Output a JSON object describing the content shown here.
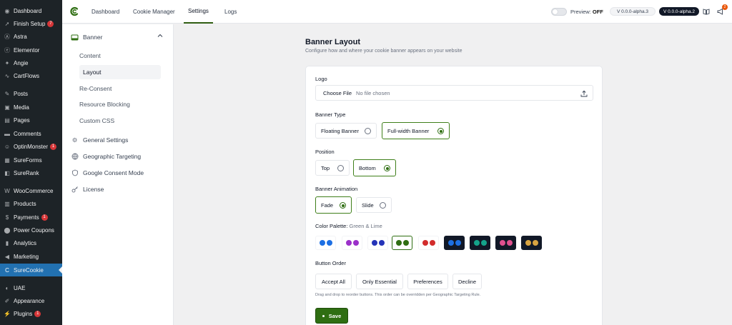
{
  "wp_sidebar": {
    "items": [
      {
        "label": "Dashboard",
        "icon": "dashboard-icon"
      },
      {
        "label": "Finish Setup",
        "icon": "rocket-icon",
        "badge": "7"
      },
      {
        "label": "Astra",
        "icon": "astra-icon"
      },
      {
        "label": "Elementor",
        "icon": "elementor-icon"
      },
      {
        "label": "Angie",
        "icon": "angie-icon"
      },
      {
        "label": "CartFlows",
        "icon": "cartflows-icon"
      },
      {
        "label": "Posts",
        "icon": "pin-icon"
      },
      {
        "label": "Media",
        "icon": "media-icon"
      },
      {
        "label": "Pages",
        "icon": "page-icon"
      },
      {
        "label": "Comments",
        "icon": "comment-icon"
      },
      {
        "label": "OptinMonster",
        "icon": "optinmonster-icon",
        "badge": "1"
      },
      {
        "label": "SureForms",
        "icon": "sureforms-icon"
      },
      {
        "label": "SureRank",
        "icon": "surerank-icon"
      },
      {
        "label": "WooCommerce",
        "icon": "woocommerce-icon"
      },
      {
        "label": "Products",
        "icon": "products-icon"
      },
      {
        "label": "Payments",
        "icon": "payments-icon",
        "badge": "1"
      },
      {
        "label": "Power Coupons",
        "icon": "coupon-icon"
      },
      {
        "label": "Analytics",
        "icon": "analytics-icon"
      },
      {
        "label": "Marketing",
        "icon": "megaphone-icon"
      },
      {
        "label": "SureCookie",
        "icon": "surecookie-icon"
      },
      {
        "label": "UAE",
        "icon": "uae-icon"
      },
      {
        "label": "Appearance",
        "icon": "brush-icon"
      },
      {
        "label": "Plugins",
        "icon": "plugin-icon",
        "badge": "1"
      }
    ]
  },
  "topbar": {
    "tabs": [
      "Dashboard",
      "Cookie Manager",
      "Settings",
      "Logs"
    ],
    "active_tab": "Settings",
    "preview_label": "Preview:",
    "preview_state": "OFF",
    "version_1": "V 0.0.0-alpha.3",
    "version_2": "V 0.0.0-alpha.2",
    "notification_count": "2"
  },
  "plugin_nav": {
    "banner_label": "Banner",
    "banner_sub": [
      "Content",
      "Layout",
      "Re-Consent",
      "Resource Blocking",
      "Custom CSS"
    ],
    "active_sub": "Layout",
    "general_settings": "General Settings",
    "geo_targeting": "Geographic Targeting",
    "google_consent": "Google Consent Mode",
    "license": "License"
  },
  "main": {
    "title": "Banner Layout",
    "subtitle": "Configure how and where your cookie banner appears on your website",
    "logo_label": "Logo",
    "file_button": "Choose File",
    "file_status": "No file chosen",
    "banner_type_label": "Banner Type",
    "banner_types": [
      "Floating Banner",
      "Full-width Banner"
    ],
    "banner_type_selected": "Full-width Banner",
    "position_label": "Position",
    "positions": [
      "Top",
      "Bottom"
    ],
    "position_selected": "Bottom",
    "animation_label": "Banner Animation",
    "animations": [
      "Fade",
      "Slide"
    ],
    "animation_selected": "Fade",
    "palette_label": "Color Palette:",
    "palette_value": "Green & Lime",
    "palettes": [
      {
        "bg": "#ffffff",
        "c1": "#1d6fe3",
        "c2": "#1d6fe3",
        "selected": false
      },
      {
        "bg": "#ffffff",
        "c1": "#9b30c9",
        "c2": "#9b30c9",
        "selected": false
      },
      {
        "bg": "#ffffff",
        "c1": "#2433b8",
        "c2": "#2433b8",
        "selected": false
      },
      {
        "bg": "#ffffff",
        "c1": "#2f6e12",
        "c2": "#2f6e12",
        "selected": true
      },
      {
        "bg": "#ffffff",
        "c1": "#d22c2c",
        "c2": "#d22c2c",
        "selected": false
      },
      {
        "bg": "#111827",
        "c1": "#1d6fe3",
        "c2": "#1d6fe3",
        "selected": false
      },
      {
        "bg": "#111827",
        "c1": "#14a38b",
        "c2": "#14a38b",
        "selected": false
      },
      {
        "bg": "#111827",
        "c1": "#e0508f",
        "c2": "#e0508f",
        "selected": false
      },
      {
        "bg": "#111827",
        "c1": "#d9a441",
        "c2": "#d9a441",
        "selected": false
      }
    ],
    "order_label": "Button Order",
    "order_buttons": [
      "Accept All",
      "Only Essential",
      "Preferences",
      "Decline"
    ],
    "order_hint": "Drag and drop to reorder buttons. This order can be overridden per Geographic Targeting Rule.",
    "save_label": "Save"
  },
  "colors": {
    "accent": "#2f6e12",
    "wp_active": "#2271b1",
    "wp_bg": "#1d2327"
  }
}
